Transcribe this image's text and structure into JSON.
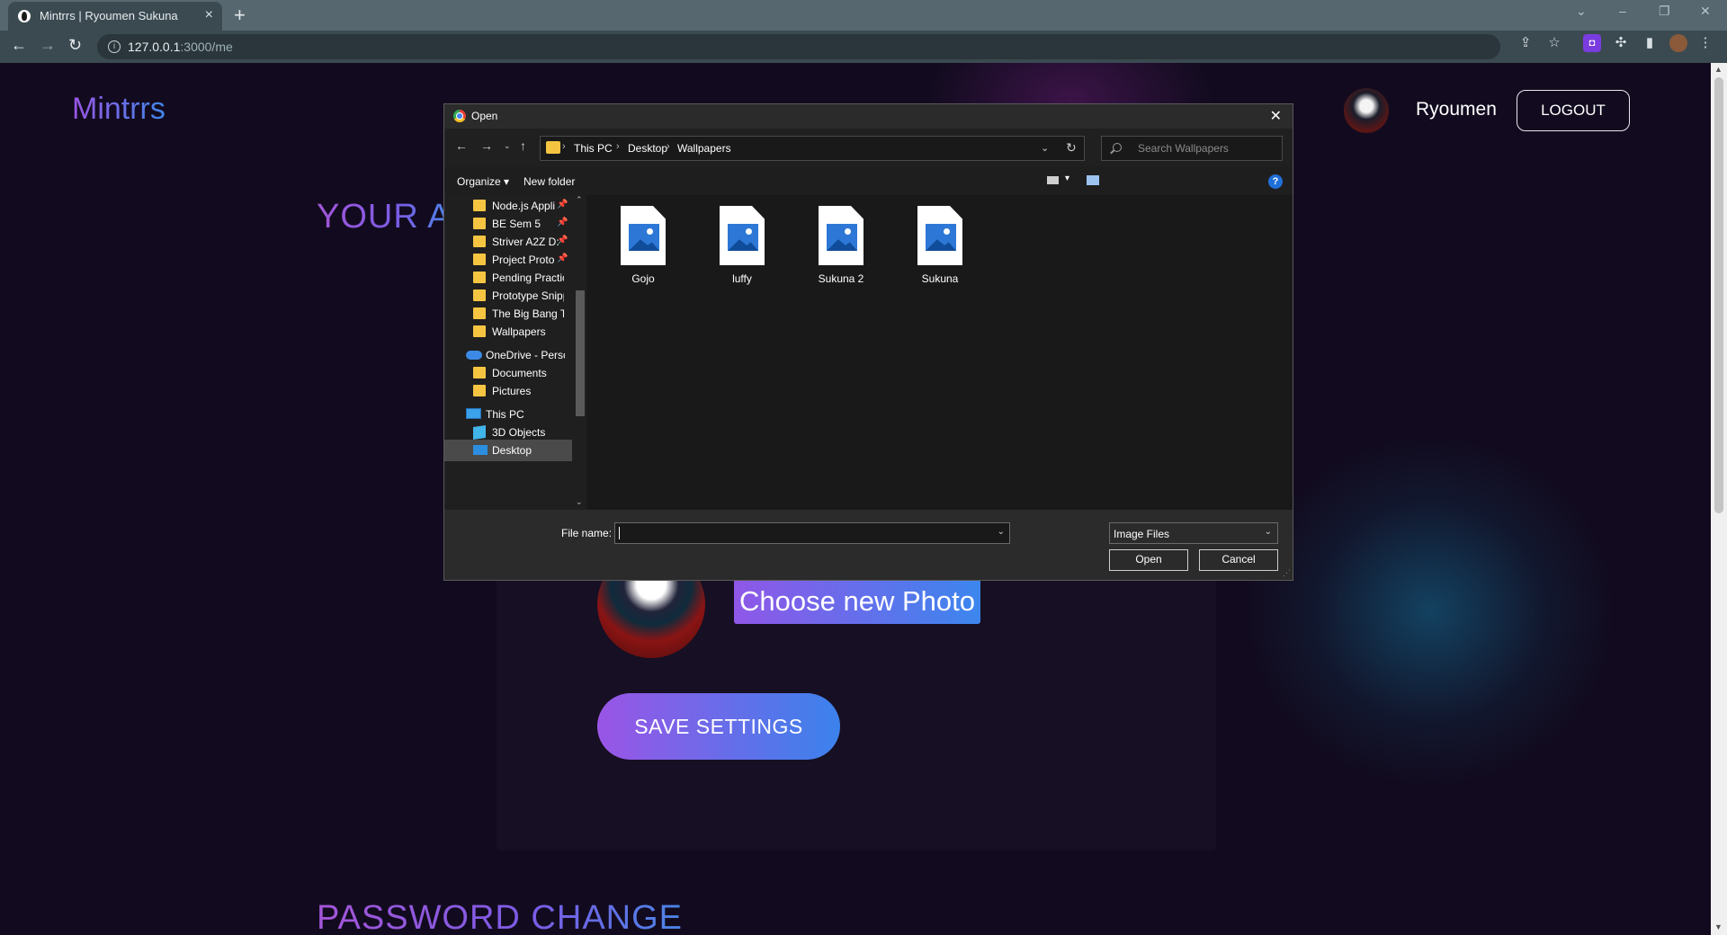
{
  "browser": {
    "tab_title": "Mintrrs | Ryoumen Sukuna",
    "url_host": "127.0.0.1",
    "url_path": ":3000/me"
  },
  "page": {
    "logo": "Mintrrs",
    "user_name": "Ryoumen",
    "logout_label": "LOGOUT",
    "section_heading_account": "YOUR A",
    "choose_photo_label": "Choose new Photo",
    "save_settings_label": "SAVE SETTINGS",
    "section_heading_password": "PASSWORD CHANGE",
    "colors": {
      "accent_purple": "#9a55e6",
      "accent_blue": "#3f86e8",
      "background": "#120b1f"
    }
  },
  "dialog": {
    "title": "Open",
    "breadcrumb": [
      "This PC",
      "Desktop",
      "Wallpapers"
    ],
    "search_placeholder": "Search Wallpapers",
    "organize_label": "Organize",
    "new_folder_label": "New folder",
    "nav_items": [
      {
        "label": "Node.js Appli",
        "pinned": true
      },
      {
        "label": "BE Sem 5",
        "pinned": true
      },
      {
        "label": "Striver A2Z D:",
        "pinned": true
      },
      {
        "label": "Project Proto",
        "pinned": true
      },
      {
        "label": "Pending Practica",
        "pinned": false
      },
      {
        "label": "Prototype Snipp",
        "pinned": false
      },
      {
        "label": "The Big Bang Th",
        "pinned": false
      },
      {
        "label": "Wallpapers",
        "pinned": false
      },
      {
        "label": "OneDrive - Persor",
        "pinned": false
      },
      {
        "label": "Documents",
        "pinned": false
      },
      {
        "label": "Pictures",
        "pinned": false
      },
      {
        "label": "This PC",
        "pinned": false
      },
      {
        "label": "3D Objects",
        "pinned": false
      },
      {
        "label": "Desktop",
        "pinned": false
      }
    ],
    "files": [
      "Gojo",
      "luffy",
      "Sukuna 2",
      "Sukuna"
    ],
    "file_name_label": "File name:",
    "file_name_value": "",
    "file_type_selected": "Image Files",
    "open_label": "Open",
    "cancel_label": "Cancel"
  }
}
